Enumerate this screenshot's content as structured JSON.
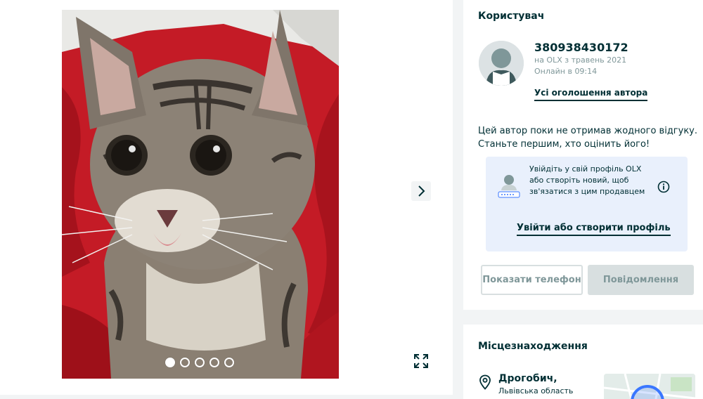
{
  "gallery": {
    "slide_count": 5,
    "active_slide": 1
  },
  "user_card": {
    "title": "Користувач",
    "phone_name": "380938430172",
    "member_since": "на OLX з травень 2021",
    "last_online": "Онлайн в 09:14",
    "all_ads_link": "Усі оголошення автора",
    "no_reviews_text": "Цей автор поки не отримав жодного відгуку. Станьте першим, хто оцінить його!",
    "login_prompt": "Увійдіть у свій профіль OLX або створіть новий, щоб зв'язатися з цим продавцем",
    "login_link": "Увійти або створити профіль",
    "show_phone_button": "Показати телефон",
    "message_button": "Повідомлення"
  },
  "location_card": {
    "title": "Місцезнаходження",
    "city": "Дрогобич,",
    "region": "Львівська область"
  },
  "colors": {
    "primary_text": "#002f34",
    "muted_text": "#7f9799",
    "login_box_bg": "#e9f0fc",
    "disabled_button_bg": "#d8dfe0",
    "photo_background": "#c11a25"
  }
}
